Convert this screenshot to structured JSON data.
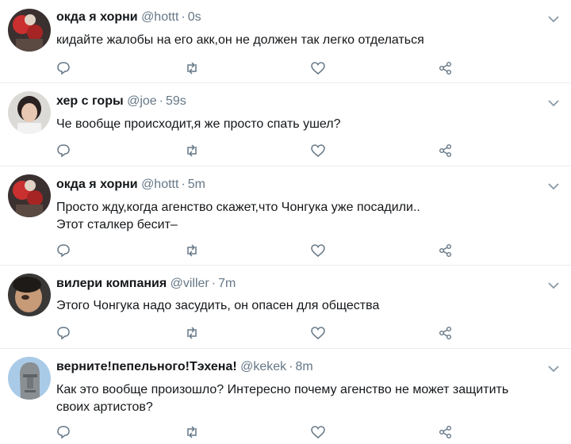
{
  "tweets": [
    {
      "name": "окда я хорни",
      "handle": "@hottt",
      "time": "0s",
      "text": "кидайте жалобы на его акк,он не должен так легко отделаться",
      "avatar": "avatar-flowers-red"
    },
    {
      "name": "хер с горы",
      "handle": "@joe",
      "time": "59s",
      "text": "Че вообще происходит,я же просто спать ушел?",
      "avatar": "avatar-dark-hair-person"
    },
    {
      "name": "окда я хорни",
      "handle": "@hottt",
      "time": "5m",
      "text": "Просто жду,когда агенство скажет,что Чонгука уже посадили..\nЭтот сталкер бесит–",
      "avatar": "avatar-flowers-red"
    },
    {
      "name": "вилери компания",
      "handle": "@viller",
      "time": "7m",
      "text": "Этого Чонгука надо засудить, он опасен для общества",
      "avatar": "avatar-face-closeup"
    },
    {
      "name": "верните!пепельного!Тэхена!",
      "handle": "@kekek",
      "time": "8m",
      "text": "Как это вообще произошло? Интересно почему агенство не может защитить своих артистов?",
      "avatar": "avatar-moai-statue"
    }
  ],
  "icons": {
    "reply": "reply-icon",
    "retweet": "retweet-icon",
    "like": "like-icon",
    "share": "share-icon",
    "caret": "chevron-down-icon"
  },
  "colors": {
    "icon": "#657786",
    "divider": "#e6ecf0",
    "text": "#14171a",
    "meta": "#657786"
  }
}
